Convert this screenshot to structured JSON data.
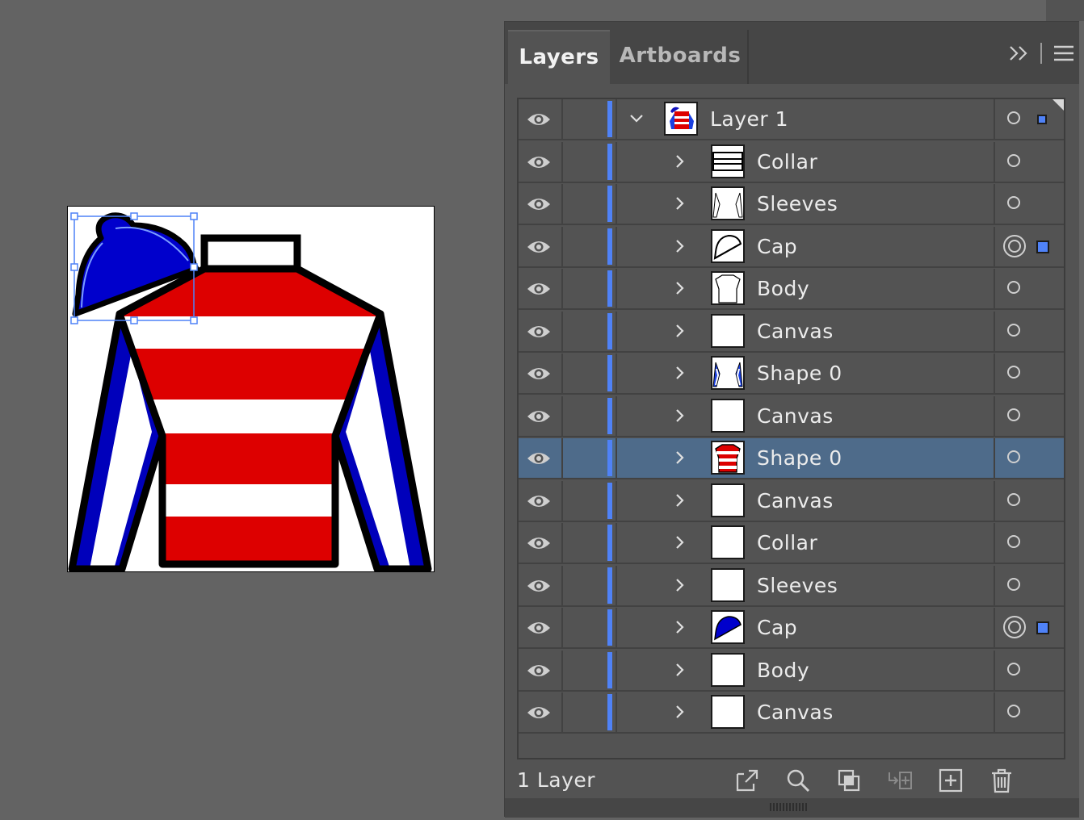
{
  "tabs": {
    "layers": "Layers",
    "artboards": "Artboards"
  },
  "icons": {
    "collapse": "double-chevron-icon",
    "menu": "hamburger-menu-icon"
  },
  "colors": {
    "accent": "#4f82f7",
    "selected_row": "#4e6b8a",
    "silk_red": "#dd0000",
    "silk_blue": "#0000bb"
  },
  "layers": [
    {
      "name": "Layer 1",
      "thumb": "layer",
      "expanded": true,
      "target": "single",
      "select": "small"
    },
    {
      "name": "Collar",
      "thumb": "collar-outline"
    },
    {
      "name": "Sleeves",
      "thumb": "sleeves-outline"
    },
    {
      "name": "Cap",
      "thumb": "cap-outline",
      "target": "double",
      "select": "box"
    },
    {
      "name": "Body",
      "thumb": "body-outline"
    },
    {
      "name": "Canvas",
      "thumb": "blank"
    },
    {
      "name": "Shape 0",
      "thumb": "sleeves-blue"
    },
    {
      "name": "Canvas",
      "thumb": "blank"
    },
    {
      "name": "Shape 0",
      "thumb": "body-striped",
      "selected": true
    },
    {
      "name": "Canvas",
      "thumb": "blank"
    },
    {
      "name": "Collar",
      "thumb": "blank"
    },
    {
      "name": "Sleeves",
      "thumb": "blank"
    },
    {
      "name": "Cap",
      "thumb": "cap-blue",
      "target": "double",
      "select": "box"
    },
    {
      "name": "Body",
      "thumb": "blank"
    },
    {
      "name": "Canvas",
      "thumb": "blank"
    }
  ],
  "footer": {
    "count_label": "1 Layer",
    "buttons": [
      "export-icon",
      "search-icon",
      "clipping-mask-icon",
      "move-to-layer-icon",
      "new-layer-icon",
      "trash-icon"
    ]
  }
}
